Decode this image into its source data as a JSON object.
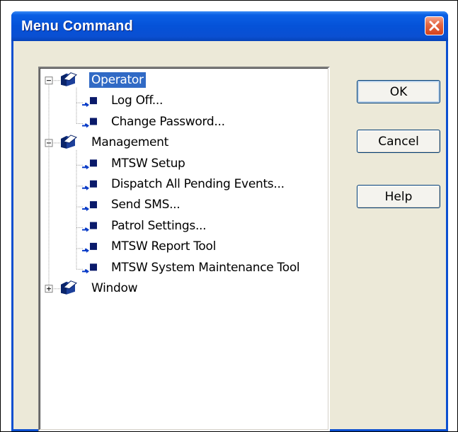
{
  "window": {
    "title": "Menu Command",
    "close_icon": "close-icon",
    "accent_color": "#0552d8",
    "close_color": "#d6421b"
  },
  "buttons": {
    "ok": "OK",
    "cancel": "Cancel",
    "help": "Help"
  },
  "tree": {
    "selection_color": "#316ac5",
    "groups": [
      {
        "label": "Operator",
        "expanded": true,
        "selected": true,
        "expander": "−",
        "items": [
          "Log Off...",
          "Change Password..."
        ]
      },
      {
        "label": "Management",
        "expanded": true,
        "selected": false,
        "expander": "−",
        "items": [
          "MTSW Setup",
          "Dispatch All Pending Events...",
          "Send SMS...",
          "Patrol Settings...",
          "MTSW Report Tool",
          "MTSW System Maintenance Tool"
        ]
      },
      {
        "label": "Window",
        "expanded": false,
        "selected": false,
        "expander": "+",
        "items": []
      }
    ]
  }
}
